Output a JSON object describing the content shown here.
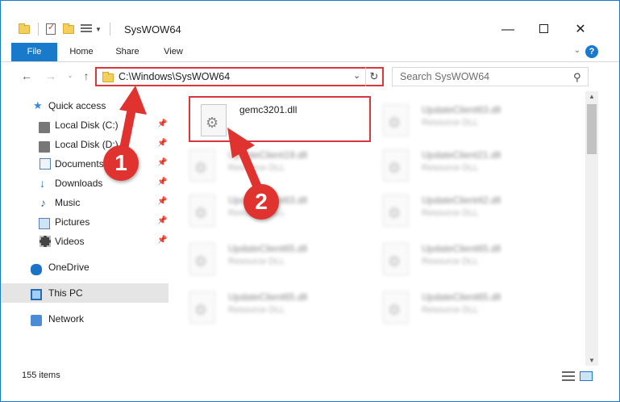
{
  "window": {
    "title": "SysWOW64",
    "minimize_glyph": "—",
    "close_glyph": "✕"
  },
  "ribbon": {
    "tabs": [
      {
        "label": "File"
      },
      {
        "label": "Home"
      },
      {
        "label": "Share"
      },
      {
        "label": "View"
      }
    ],
    "expand_glyph": "⌄",
    "help_glyph": "?"
  },
  "address_bar": {
    "path": "C:\\Windows\\SysWOW64",
    "dropdown_glyph": "⌄",
    "refresh_glyph": "↻"
  },
  "nav_buttons": {
    "back_glyph": "←",
    "forward_glyph": "→",
    "recent_glyph": "⌄",
    "up_glyph": "↑"
  },
  "search": {
    "placeholder": "Search SysWOW64",
    "icon_glyph": "⚲"
  },
  "sidebar": {
    "items": [
      {
        "label": "Quick access",
        "icon": "star-icon",
        "pinned": false
      },
      {
        "label": "Local Disk (C:)",
        "icon": "disk-icon",
        "pinned": true
      },
      {
        "label": "Local Disk (D:)",
        "icon": "disk-icon",
        "pinned": true
      },
      {
        "label": "Documents",
        "icon": "documents-icon",
        "pinned": true
      },
      {
        "label": "Downloads",
        "icon": "downloads-icon",
        "pinned": true
      },
      {
        "label": "Music",
        "icon": "music-icon",
        "pinned": true
      },
      {
        "label": "Pictures",
        "icon": "pictures-icon",
        "pinned": true
      },
      {
        "label": "Videos",
        "icon": "videos-icon",
        "pinned": true
      },
      {
        "label": "OneDrive",
        "icon": "onedrive-icon",
        "pinned": false
      },
      {
        "label": "This PC",
        "icon": "this-pc-icon",
        "pinned": false,
        "selected": true
      },
      {
        "label": "Network",
        "icon": "network-icon",
        "pinned": false
      }
    ],
    "pin_glyph": "📌",
    "star_glyph": "★",
    "music_glyph": "♪",
    "download_glyph": "↓"
  },
  "files": {
    "highlighted": {
      "name": "gemc3201.dll"
    },
    "blurred": [
      {
        "name": "UpdateClient63.dll",
        "type": "Resource DLL"
      },
      {
        "name": "UpdateClient19.dll",
        "type": "Resource DLL"
      },
      {
        "name": "UpdateClient21.dll",
        "type": "Resource DLL"
      },
      {
        "name": "UpdateClient63.dll",
        "type": "Resource DLL"
      },
      {
        "name": "UpdateClient42.dll",
        "type": "Resource DLL"
      },
      {
        "name": "UpdateClient65.dll",
        "type": "Resource DLL"
      },
      {
        "name": "UpdateClient65.dll",
        "type": "Resource DLL"
      },
      {
        "name": "UpdateClient65.dll",
        "type": "Resource DLL"
      },
      {
        "name": "UpdateClient65.dll",
        "type": "Resource DLL"
      }
    ]
  },
  "scrollbar": {
    "up_glyph": "▲",
    "down_glyph": "▼"
  },
  "status": {
    "item_count": "155 items"
  },
  "annotations": {
    "step1": "1",
    "step2": "2",
    "accent_color": "#e0332f"
  },
  "colors": {
    "accent": "#1979ca",
    "highlight_border": "#d9373c"
  }
}
